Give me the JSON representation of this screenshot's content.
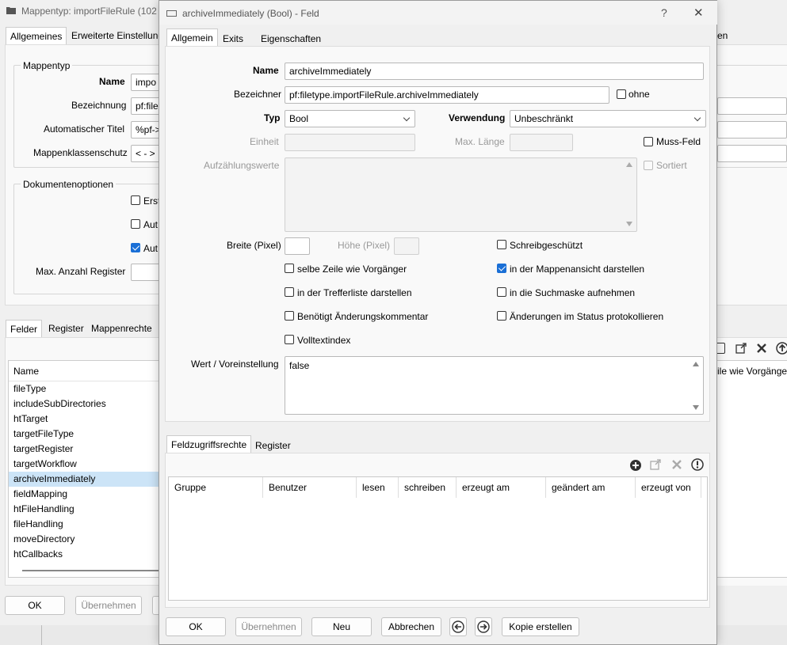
{
  "bg": {
    "title": "Mappentyp:  importFileRule (102",
    "tabs": [
      "Allgemeines",
      "Erweiterte Einstellung"
    ],
    "tab_right_fragment": "en",
    "group_mappentyp": "Mappentyp",
    "name_label": "Name",
    "name_value": "impo",
    "bezeichnung_label": "Bezeichnung",
    "bezeichnung_value": "pf:file",
    "auto_title_label": "Automatischer Titel",
    "auto_title_value": "%pf->",
    "schutz_label": "Mappenklassenschutz",
    "schutz_value": "< - >",
    "group_dok": "Dokumentenoptionen",
    "opt1": "Erst",
    "opt2": "Aut",
    "opt3": "Aut",
    "max_register_label": "Max. Anzahl  Register",
    "lower_tabs": [
      "Felder",
      "Register",
      "Mappenrechte"
    ],
    "list_header": "Name",
    "list_header_right": "ile wie Vorgänger",
    "list_items": [
      "fileType",
      "includeSubDirectories",
      "htTarget",
      "targetFileType",
      "targetRegister",
      "targetWorkflow",
      "archiveImmediately",
      "fieldMapping",
      "htFileHandling",
      "fileHandling",
      "moveDirectory",
      "htCallbacks"
    ],
    "selected_index": 6,
    "ok": "OK",
    "apply": "Übernehmen"
  },
  "dialog": {
    "title": "archiveImmediately (Bool) - Feld",
    "help": "?",
    "close": "✕",
    "tabs": [
      "Allgemein",
      "Exits",
      "Eigenschaften"
    ],
    "name_label": "Name",
    "name_value": "archiveImmediately",
    "bez_label": "Bezeichner",
    "bez_value": "pf:filetype.importFileRule.archiveImmediately",
    "ohne_label": "ohne",
    "typ_label": "Typ",
    "typ_value": "Bool",
    "verwendung_label": "Verwendung",
    "verwendung_value": "Unbeschränkt",
    "einheit_label": "Einheit",
    "maxlen_label": "Max. Länge",
    "muss_label": "Muss-Feld",
    "aufz_label": "Aufzählungswerte",
    "sortiert_label": "Sortiert",
    "breite_label": "Breite (Pixel)",
    "hoehe_label": "Höhe (Pixel)",
    "checkboxes": {
      "schreibgeschuetzt": "Schreibgeschützt",
      "selbe_zeile": "selbe Zeile wie Vorgänger",
      "mappenansicht": "in der Mappenansicht darstellen",
      "trefferliste": "in der Trefferliste darstellen",
      "suchmaske": "in die Suchmaske aufnehmen",
      "kommentar": "Benötigt Änderungskommentar",
      "status": "Änderungen im Status protokollieren",
      "volltext": "Volltextindex"
    },
    "wert_label": "Wert / Voreinstellung",
    "wert_value": "false",
    "lower_tabs": [
      "Feldzugriffsrechte",
      "Register"
    ],
    "columns": [
      "Gruppe",
      "Benutzer",
      "lesen",
      "schreiben",
      "erzeugt am",
      "geändert am",
      "erzeugt von"
    ],
    "buttons": {
      "ok": "OK",
      "apply": "Übernehmen",
      "new": "Neu",
      "cancel": "Abbrechen",
      "copy": "Kopie erstellen"
    }
  }
}
